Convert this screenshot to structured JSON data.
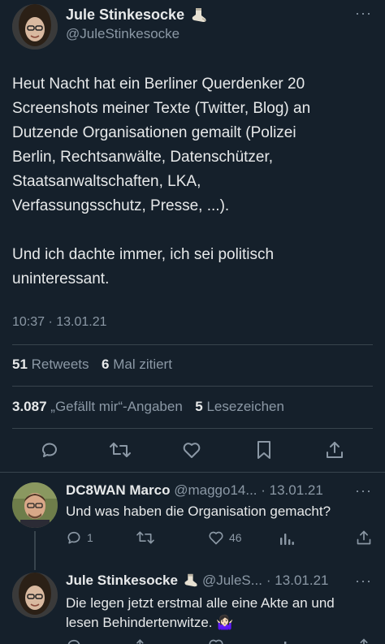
{
  "main_tweet": {
    "author_name": "Jule Stinkesocke",
    "author_handle": "@JuleStinkesocke",
    "text_lines": [
      "Heut Nacht hat ein Berliner Querdenker 20",
      "Screenshots meiner Texte (Twitter, Blog) an",
      "Dutzende Organisationen gemailt (Polizei",
      "Berlin, Rechtsanwälte, Datenschützer,",
      "Staatsanwaltschaften, LKA,",
      "Verfassungsschutz, Presse, ...).",
      "",
      "Und ich dachte immer, ich sei politisch",
      "uninteressant."
    ],
    "timestamp": "10:37 · 13.01.21",
    "retweets_count": "51",
    "retweets_label": "Retweets",
    "quotes_count": "6",
    "quotes_label": "Mal zitiert",
    "likes_count": "3.087",
    "likes_label": "„Gefällt mir“-Angaben",
    "bookmarks_count": "5",
    "bookmarks_label": "Lesezeichen"
  },
  "replies": [
    {
      "author_name": "DC8WAN Marco",
      "author_handle": "@maggo14...",
      "date": "· 13.01.21",
      "text": "Und was haben die Organisation gemacht?",
      "reply_count": "1",
      "like_count": "46"
    },
    {
      "author_name": "Jule Stinkesocke",
      "author_handle": "@JuleS...",
      "date": "· 13.01.21",
      "text_lines": [
        "Die legen jetzt erstmal alle eine Akte an und",
        "lesen Behindertenwitze. 🤷🏻‍♀️"
      ]
    }
  ],
  "icons": {
    "more": "more-icon",
    "sock": "sock-icon",
    "reply": "reply-icon",
    "retweet": "retweet-icon",
    "like": "like-icon",
    "bookmark": "bookmark-icon",
    "share": "share-icon",
    "views": "views-icon"
  },
  "colors": {
    "background": "#15202b",
    "text": "#e7e9ea",
    "secondary": "#8b98a5",
    "divider": "#38444d"
  }
}
